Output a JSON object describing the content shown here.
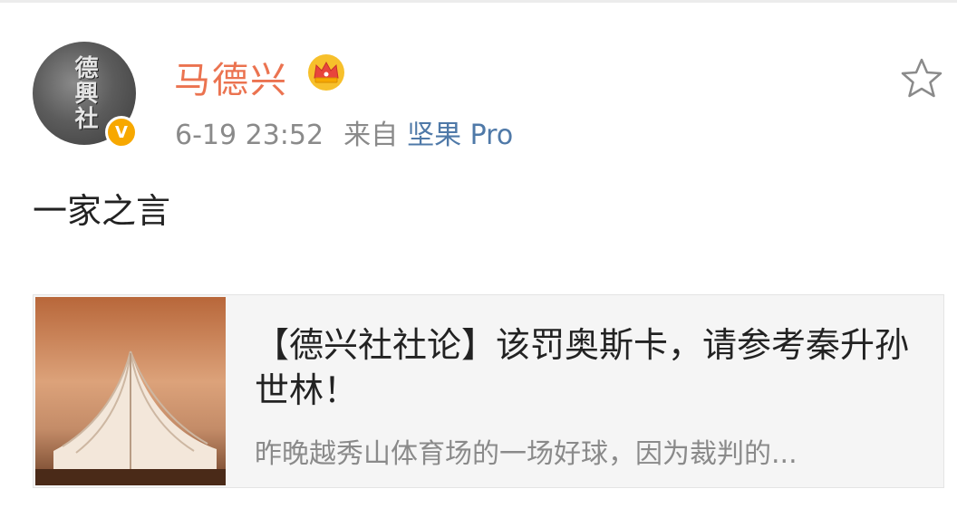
{
  "user": {
    "name": "马德兴",
    "avatar_text": "德興社",
    "verified_badge": "V"
  },
  "meta": {
    "time": "6-19 23:52",
    "source_prefix": "来自",
    "device": "坚果 Pro"
  },
  "post": {
    "text": "一家之言"
  },
  "article_card": {
    "title": "【德兴社社论】该罚奥斯卡，请参考秦升孙世林！",
    "summary": "昨晚越秀山体育场的一场好球，因为裁判的..."
  },
  "colors": {
    "username": "#eb7350",
    "link": "#4f79a8",
    "badge": "#f7a800",
    "meta_text": "#8a8a8a"
  },
  "icons": {
    "crown": "vip-crown-icon",
    "star": "favorite-star-icon",
    "verified": "verified-badge-icon"
  }
}
